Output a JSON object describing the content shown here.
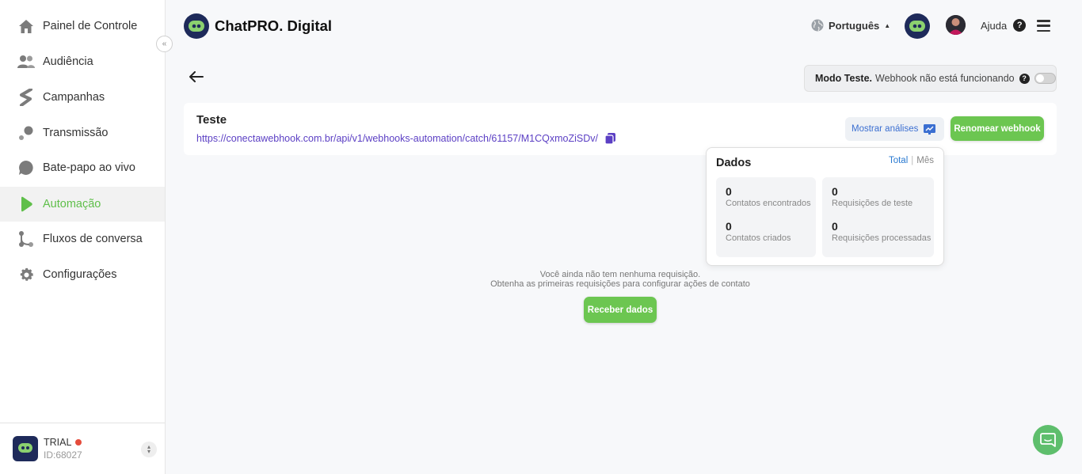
{
  "sidebar": {
    "items": [
      {
        "label": "Painel de Controle",
        "icon": "home-icon"
      },
      {
        "label": "Audiência",
        "icon": "people-icon"
      },
      {
        "label": "Campanhas",
        "icon": "campaign-icon"
      },
      {
        "label": "Transmissão",
        "icon": "broadcast-icon"
      },
      {
        "label": "Bate-papo ao vivo",
        "icon": "chat-icon"
      },
      {
        "label": "Automação",
        "icon": "play-icon",
        "active": true
      },
      {
        "label": "Fluxos de conversa",
        "icon": "flow-icon"
      },
      {
        "label": "Configurações",
        "icon": "gear-icon"
      }
    ],
    "footer": {
      "plan": "TRIAL",
      "id": "ID:68027"
    }
  },
  "header": {
    "brand": "ChatPRO. Digital",
    "language": "Português",
    "help": "Ajuda"
  },
  "test_mode": {
    "title": "Modo Teste.",
    "text": "Webhook não está funcionando",
    "enabled": false
  },
  "webhook": {
    "title": "Teste",
    "url": "https://conectawebhook.com.br/api/v1/webhooks-automation/catch/61157/M1CQxmoZiSDv/",
    "show_analyses": "Mostrar análises",
    "rename": "Renomear webhook"
  },
  "dados": {
    "title": "Dados",
    "tab_total": "Total",
    "tab_month": "Mês",
    "stats": {
      "contacts_found": {
        "value": "0",
        "label": "Contatos encontrados"
      },
      "contacts_created": {
        "value": "0",
        "label": "Contatos criados"
      },
      "test_requests": {
        "value": "0",
        "label": "Requisições de teste"
      },
      "processed_requests": {
        "value": "0",
        "label": "Requisições processadas"
      }
    }
  },
  "empty_state": {
    "line1": "Você ainda não tem nenhuma requisição.",
    "line2": "Obtenha as primeiras requisições para configurar ações de contato",
    "button": "Receber dados"
  },
  "colors": {
    "accent_green": "#6cc651",
    "link_purple": "#5b3fc4",
    "brand_navy": "#1e2a5a"
  }
}
